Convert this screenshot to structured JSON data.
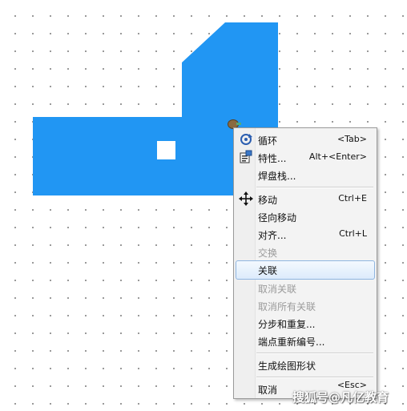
{
  "colors": {
    "copper": "#2196f3",
    "menu_bg": "#f3f3f3",
    "highlight_border": "#8fb5e0"
  },
  "context_menu": {
    "items": [
      {
        "label": "循环",
        "shortcut": "<Tab>",
        "icon": "cycle-icon",
        "enabled": true
      },
      {
        "label": "特性...",
        "shortcut": "Alt+<Enter>",
        "icon": "properties-icon",
        "enabled": true
      },
      {
        "label": "焊盘栈...",
        "shortcut": "",
        "icon": "",
        "enabled": true
      },
      {
        "label": "移动",
        "shortcut": "Ctrl+E",
        "icon": "move-icon",
        "enabled": true
      },
      {
        "label": "径向移动",
        "shortcut": "",
        "icon": "",
        "enabled": true
      },
      {
        "label": "对齐...",
        "shortcut": "Ctrl+L",
        "icon": "",
        "enabled": true
      },
      {
        "label": "交换",
        "shortcut": "",
        "icon": "",
        "enabled": false
      },
      {
        "label": "关联",
        "shortcut": "",
        "icon": "",
        "enabled": true,
        "highlighted": true
      },
      {
        "label": "取消关联",
        "shortcut": "",
        "icon": "",
        "enabled": false
      },
      {
        "label": "取消所有关联",
        "shortcut": "",
        "icon": "",
        "enabled": false
      },
      {
        "label": "分步和重复...",
        "shortcut": "",
        "icon": "",
        "enabled": true
      },
      {
        "label": "端点重新编号...",
        "shortcut": "",
        "icon": "",
        "enabled": true
      },
      {
        "label": "生成绘图形状",
        "shortcut": "",
        "icon": "",
        "enabled": true
      },
      {
        "label": "取消",
        "shortcut": "<Esc>",
        "icon": "",
        "enabled": true
      }
    ]
  },
  "watermark": "搜狐号@凡亿教育"
}
